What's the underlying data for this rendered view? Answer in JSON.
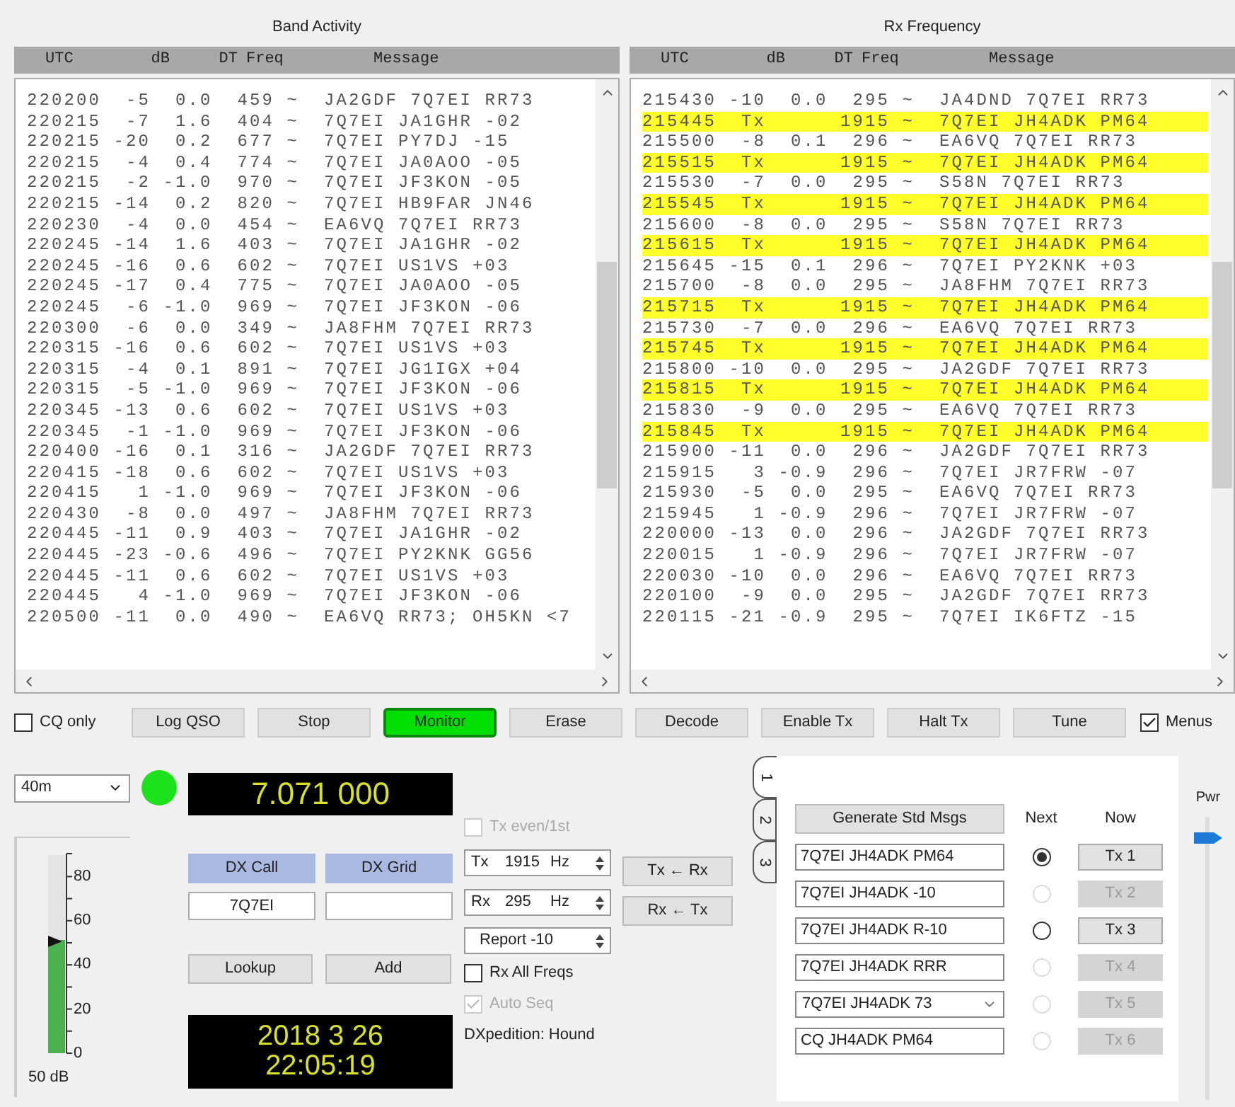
{
  "band_activity": {
    "title": "Band Activity",
    "columns": [
      "UTC",
      "dB",
      "DT",
      "Freq",
      "Message"
    ],
    "rows": [
      {
        "text": "220200  -5  0.0  459 ~  JA2GDF 7Q7EI RR73"
      },
      {
        "text": "220215  -7  1.6  404 ~  7Q7EI JA1GHR -02"
      },
      {
        "text": "220215 -20  0.2  677 ~  7Q7EI PY7DJ -15"
      },
      {
        "text": "220215  -4  0.4  774 ~  7Q7EI JA0AOO -05"
      },
      {
        "text": "220215  -2 -1.0  970 ~  7Q7EI JF3KON -05"
      },
      {
        "text": "220215 -14  0.2  820 ~  7Q7EI HB9FAR JN46"
      },
      {
        "text": "220230  -4  0.0  454 ~  EA6VQ 7Q7EI RR73"
      },
      {
        "text": "220245 -14  1.6  403 ~  7Q7EI JA1GHR -02"
      },
      {
        "text": "220245 -16  0.6  602 ~  7Q7EI US1VS +03"
      },
      {
        "text": "220245 -17  0.4  775 ~  7Q7EI JA0AOO -05"
      },
      {
        "text": "220245  -6 -1.0  969 ~  7Q7EI JF3KON -06"
      },
      {
        "text": "220300  -6  0.0  349 ~  JA8FHM 7Q7EI RR73"
      },
      {
        "text": "220315 -16  0.6  602 ~  7Q7EI US1VS +03"
      },
      {
        "text": "220315  -4  0.1  891 ~  7Q7EI JG1IGX +04"
      },
      {
        "text": "220315  -5 -1.0  969 ~  7Q7EI JF3KON -06"
      },
      {
        "text": "220345 -13  0.6  602 ~  7Q7EI US1VS +03"
      },
      {
        "text": "220345  -1 -1.0  969 ~  7Q7EI JF3KON -06"
      },
      {
        "text": "220400 -16  0.1  316 ~  JA2GDF 7Q7EI RR73"
      },
      {
        "text": "220415 -18  0.6  602 ~  7Q7EI US1VS +03"
      },
      {
        "text": "220415   1 -1.0  969 ~  7Q7EI JF3KON -06"
      },
      {
        "text": "220430  -8  0.0  497 ~  JA8FHM 7Q7EI RR73"
      },
      {
        "text": "220445 -11  0.9  403 ~  7Q7EI JA1GHR -02"
      },
      {
        "text": "220445 -23 -0.6  496 ~  7Q7EI PY2KNK GG56"
      },
      {
        "text": "220445 -11  0.6  602 ~  7Q7EI US1VS +03"
      },
      {
        "text": "220445   4 -1.0  969 ~  7Q7EI JF3KON -06"
      },
      {
        "text": "220500 -11  0.0  490 ~  EA6VQ RR73; OH5KN <7"
      }
    ]
  },
  "rx_frequency": {
    "title": "Rx Frequency",
    "columns": [
      "UTC",
      "dB",
      "DT",
      "Freq",
      "Message"
    ],
    "rows": [
      {
        "text": "215430 -10  0.0  295 ~  JA4DND 7Q7EI RR73",
        "kind": "rx"
      },
      {
        "text": "215445  Tx      1915 ~  7Q7EI JH4ADK PM64",
        "kind": "tx"
      },
      {
        "text": "215500  -8  0.1  296 ~  EA6VQ 7Q7EI RR73",
        "kind": "rx"
      },
      {
        "text": "215515  Tx      1915 ~  7Q7EI JH4ADK PM64",
        "kind": "tx"
      },
      {
        "text": "215530  -7  0.0  295 ~  S58N 7Q7EI RR73",
        "kind": "rx"
      },
      {
        "text": "215545  Tx      1915 ~  7Q7EI JH4ADK PM64",
        "kind": "tx"
      },
      {
        "text": "215600  -8  0.0  295 ~  S58N 7Q7EI RR73",
        "kind": "rx"
      },
      {
        "text": "215615  Tx      1915 ~  7Q7EI JH4ADK PM64",
        "kind": "tx"
      },
      {
        "text": "215645 -15  0.1  296 ~  7Q7EI PY2KNK +03",
        "kind": "rx"
      },
      {
        "text": "215700  -8  0.0  295 ~  JA8FHM 7Q7EI RR73",
        "kind": "rx"
      },
      {
        "text": "215715  Tx      1915 ~  7Q7EI JH4ADK PM64",
        "kind": "tx"
      },
      {
        "text": "215730  -7  0.0  296 ~  EA6VQ 7Q7EI RR73",
        "kind": "rx"
      },
      {
        "text": "215745  Tx      1915 ~  7Q7EI JH4ADK PM64",
        "kind": "tx"
      },
      {
        "text": "215800 -10  0.0  295 ~  JA2GDF 7Q7EI RR73",
        "kind": "rx"
      },
      {
        "text": "215815  Tx      1915 ~  7Q7EI JH4ADK PM64",
        "kind": "tx"
      },
      {
        "text": "215830  -9  0.0  295 ~  EA6VQ 7Q7EI RR73",
        "kind": "rx"
      },
      {
        "text": "215845  Tx      1915 ~  7Q7EI JH4ADK PM64",
        "kind": "tx"
      },
      {
        "text": "215900 -11  0.0  296 ~  JA2GDF 7Q7EI RR73",
        "kind": "rx"
      },
      {
        "text": "215915   3 -0.9  296 ~  7Q7EI JR7FRW -07",
        "kind": "rx"
      },
      {
        "text": "215930  -5  0.0  295 ~  EA6VQ 7Q7EI RR73",
        "kind": "rx"
      },
      {
        "text": "215945   1 -0.9  296 ~  7Q7EI JR7FRW -07",
        "kind": "rx"
      },
      {
        "text": "220000 -13  0.0  296 ~  JA2GDF 7Q7EI RR73",
        "kind": "rx"
      },
      {
        "text": "220015   1 -0.9  296 ~  7Q7EI JR7FRW -07",
        "kind": "rx"
      },
      {
        "text": "220030 -10  0.0  296 ~  EA6VQ 7Q7EI RR73",
        "kind": "rx"
      },
      {
        "text": "220100  -9  0.0  295 ~  JA2GDF 7Q7EI RR73",
        "kind": "rx"
      },
      {
        "text": "220115 -21 -0.9  295 ~  7Q7EI IK6FTZ -15",
        "kind": "rx"
      }
    ]
  },
  "toolbar": {
    "cq_only": {
      "label": "CQ only",
      "checked": false
    },
    "buttons": [
      {
        "label": "Log QSO",
        "on": false
      },
      {
        "label": "Stop",
        "on": false
      },
      {
        "label": "Monitor",
        "on": true
      },
      {
        "label": "Erase",
        "on": false
      },
      {
        "label": "Decode",
        "on": false
      },
      {
        "label": "Enable Tx",
        "on": false
      },
      {
        "label": "Halt Tx",
        "on": false
      },
      {
        "label": "Tune",
        "on": false
      }
    ],
    "menus": {
      "label": "Menus",
      "checked": true
    }
  },
  "band": "40m",
  "dial_frequency": "7.071 000",
  "signal_meter": {
    "ticks": [
      "80",
      "60",
      "40",
      "20",
      "0"
    ],
    "level": 0.57,
    "reading": "50 dB"
  },
  "dx": {
    "call_label": "DX Call",
    "grid_label": "DX Grid",
    "call": "7Q7EI",
    "lookup": "Lookup",
    "add": "Add"
  },
  "clock": {
    "date": "2018 3 26",
    "time": "22:05:19"
  },
  "options": {
    "tx_even": {
      "label": "Tx even/1st",
      "checked": false,
      "disabled": true
    },
    "tx_freq": {
      "prefix": "Tx",
      "value": "1915",
      "unit": "Hz"
    },
    "rx_freq": {
      "prefix": "Rx",
      "value": "295",
      "unit": "Hz"
    },
    "report": "Report -10",
    "rx_all_freqs": {
      "label": "Rx All Freqs",
      "checked": false,
      "disabled": false
    },
    "auto_seq": {
      "label": "Auto Seq",
      "checked": true,
      "disabled": true
    },
    "mode": "DXpedition: Hound"
  },
  "swap_buttons": [
    "Tx ← Rx",
    "Rx ← Tx"
  ],
  "message_tabs": [
    {
      "label": "1",
      "selected": true
    },
    {
      "label": "2",
      "selected": false
    },
    {
      "label": "3",
      "selected": false
    }
  ],
  "messages": {
    "generate": "Generate Std Msgs",
    "next_label": "Next",
    "now_label": "Now",
    "rows": [
      {
        "kind": "field",
        "text": "7Q7EI JH4ADK PM64",
        "next_selected": true,
        "enabled": true,
        "button": "Tx 1"
      },
      {
        "kind": "field",
        "text": "7Q7EI JH4ADK -10",
        "next_selected": false,
        "enabled": false,
        "button": "Tx 2"
      },
      {
        "kind": "field",
        "text": "7Q7EI JH4ADK R-10",
        "next_selected": false,
        "enabled": true,
        "button": "Tx 3"
      },
      {
        "kind": "field",
        "text": "7Q7EI JH4ADK RRR",
        "next_selected": false,
        "enabled": false,
        "button": "Tx 4"
      },
      {
        "kind": "combo",
        "text": "7Q7EI JH4ADK 73",
        "next_selected": false,
        "enabled": false,
        "button": "Tx 5"
      },
      {
        "kind": "field",
        "text": "CQ JH4ADK PM64",
        "next_selected": false,
        "enabled": false,
        "button": "Tx 6"
      }
    ]
  },
  "power": {
    "label": "Pwr",
    "level": 0.95
  }
}
